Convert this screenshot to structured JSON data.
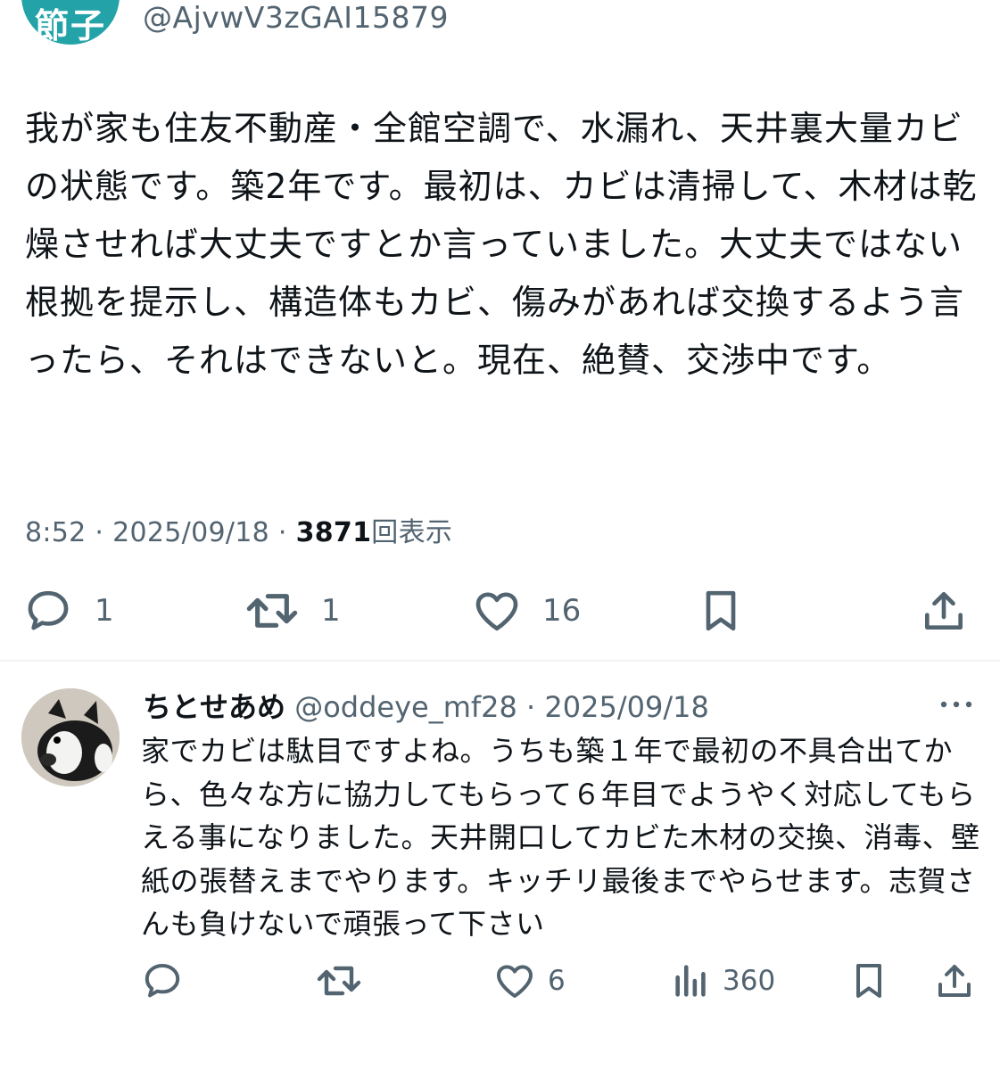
{
  "top_tweet": {
    "avatar_text": "節子",
    "handle": "@AjvwV3zGAI15879",
    "text": "我が家も住友不動産・全館空調で、水漏れ、天井裏大量カビの状態です。築2年です。最初は、カビは清掃して、木材は乾燥させれば大丈夫ですとか言っていました。大丈夫ではない根拠を提示し、構造体もカビ、傷みがあれば交換するよう言ったら、それはできないと。現在、絶賛、交渉中です。",
    "time": "8:52",
    "date": "2025/09/18",
    "sep": "·",
    "views": "3871",
    "views_label": "回表示",
    "actions": {
      "reply_count": "1",
      "retweet_count": "1",
      "like_count": "16"
    }
  },
  "reply_tweet": {
    "name": "ちとせあめ",
    "handle": "@oddeye_mf28",
    "sep": "·",
    "date": "2025/09/18",
    "text": "家でカビは駄目ですよね。うちも築１年で最初の不具合出てから、色々な方に協力してもらって６年目でようやく対応してもらえる事になりました。天井開口してカビた木材の交換、消毒、壁紙の張替えまでやります。キッチリ最後までやらせます。志賀さんも負けないで頑張って下さい",
    "actions": {
      "like_count": "6",
      "views_count": "360"
    }
  },
  "icons": [
    "reply-icon",
    "retweet-icon",
    "like-icon",
    "bookmark-icon",
    "share-icon",
    "views-icon",
    "more-icon"
  ],
  "colors": {
    "accent_avatar": "#23a3a8",
    "secondary_text": "#536471",
    "primary_text": "#0f1419"
  }
}
